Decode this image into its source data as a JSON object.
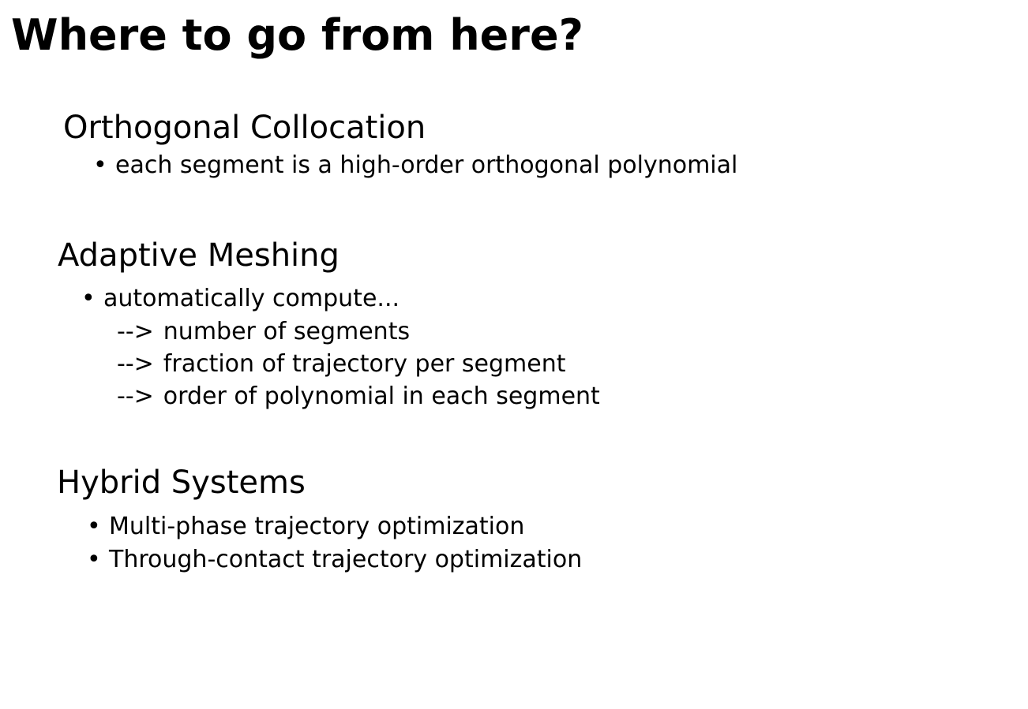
{
  "slide": {
    "title": "Where to go from here?",
    "bullet_glyph": "•",
    "sections": [
      {
        "heading": "Orthogonal Collocation",
        "bullets": [
          {
            "text": "each segment is a high-order orthogonal polynomial"
          }
        ]
      },
      {
        "heading": "Adaptive Meshing",
        "bullets": [
          {
            "text": "automatically compute...",
            "sub_prefix": "-->",
            "sub_items": [
              "number of segments",
              "fraction of trajectory per segment",
              "order of polynomial in each segment"
            ]
          }
        ]
      },
      {
        "heading": "Hybrid Systems",
        "bullets": [
          {
            "text": "Multi-phase trajectory optimization"
          },
          {
            "text": "Through-contact trajectory optimization"
          }
        ]
      }
    ]
  }
}
